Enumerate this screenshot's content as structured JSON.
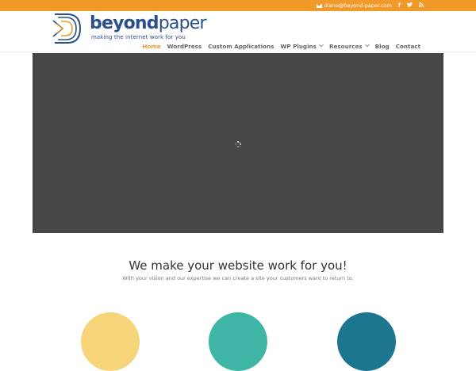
{
  "topbar": {
    "email": "diane@beyond-paper.com",
    "social": [
      {
        "icon": "facebook-icon",
        "glyph": "f"
      },
      {
        "icon": "twitter-icon",
        "glyph": "t"
      },
      {
        "icon": "rss-icon",
        "glyph": ")"
      }
    ],
    "color": "#f19a2a"
  },
  "logo": {
    "brand_bold": "beyond",
    "brand_light": "paper",
    "tagline": "making the internet work for you"
  },
  "nav": {
    "items": [
      {
        "label": "Home",
        "active": true,
        "dropdown": false
      },
      {
        "label": "WordPress",
        "active": false,
        "dropdown": false
      },
      {
        "label": "Custom Applications",
        "active": false,
        "dropdown": false
      },
      {
        "label": "WP Plugins",
        "active": false,
        "dropdown": true
      },
      {
        "label": "Resources",
        "active": false,
        "dropdown": true
      },
      {
        "label": "Blog",
        "active": false,
        "dropdown": false
      },
      {
        "label": "Contact",
        "active": false,
        "dropdown": false
      }
    ],
    "active_color": "#f19a2a"
  },
  "hero": {
    "background": "#474747",
    "loading_icon": "spinner-icon"
  },
  "intro": {
    "headline": "We make your website work for you!",
    "subline": "With your vision and our expertise we can create a site your customers want to return to."
  },
  "features": {
    "colors": [
      "#f6d57a",
      "#3fb5a5",
      "#1d7690"
    ]
  }
}
